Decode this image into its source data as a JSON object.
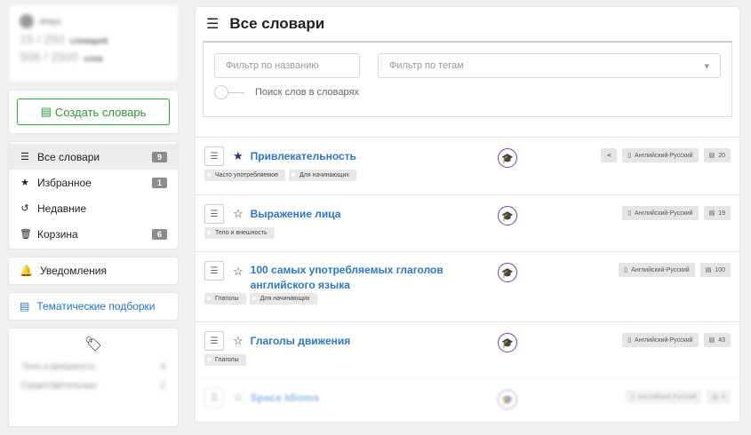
{
  "profile": {
    "username": "ohayu",
    "dict_stat": "15 / 250",
    "dict_label": "словарей",
    "word_stat": "508 / 2500",
    "word_label": "слов"
  },
  "sidebar": {
    "create_label": "Создать словарь",
    "nav": [
      {
        "label": "Все словари",
        "count": "9",
        "icon": "list-icon"
      },
      {
        "label": "Избранное",
        "count": "1",
        "icon": "star-icon"
      },
      {
        "label": "Недавние",
        "count": "",
        "icon": "history-icon"
      },
      {
        "label": "Корзина",
        "count": "6",
        "icon": "trash-icon"
      }
    ],
    "notifications": "Уведомления",
    "collections": "Тематические подборки",
    "tags": [
      {
        "label": "Тело и внешность",
        "count": "4"
      },
      {
        "label": "Существительные",
        "count": "2"
      }
    ]
  },
  "main": {
    "title": "Все словари",
    "filter_name_placeholder": "Фильтр по названию",
    "filter_tags_placeholder": "Фильтр по тегам",
    "search_words_label": "Поиск слов в словарях"
  },
  "dictionaries": [
    {
      "title": "Привлекательность",
      "favorite": true,
      "lang": "Английский-Русский",
      "words": "20",
      "shared": true,
      "tags": [
        "Часто употребляемое",
        "Для начинающих"
      ]
    },
    {
      "title": "Выражение лица",
      "favorite": false,
      "lang": "Английский-Русский",
      "words": "19",
      "shared": false,
      "tags": [
        "Тело и внешность"
      ]
    },
    {
      "title": "100 самых употребляемых глаголов английского языка",
      "favorite": false,
      "lang": "Английский-Русский",
      "words": "100",
      "shared": false,
      "tags": [
        "Глаголы",
        "Для начинающих"
      ]
    },
    {
      "title": "Глаголы движения",
      "favorite": false,
      "lang": "Английский-Русский",
      "words": "43",
      "shared": false,
      "tags": [
        "Глаголы"
      ]
    },
    {
      "title": "Space Idioms",
      "favorite": false,
      "lang": "Английский-Русский",
      "words": "5",
      "shared": false,
      "tags": []
    }
  ],
  "colors": {
    "accent": "#2a78c7",
    "green": "#27ae3a",
    "purple": "#7b3fb5"
  }
}
